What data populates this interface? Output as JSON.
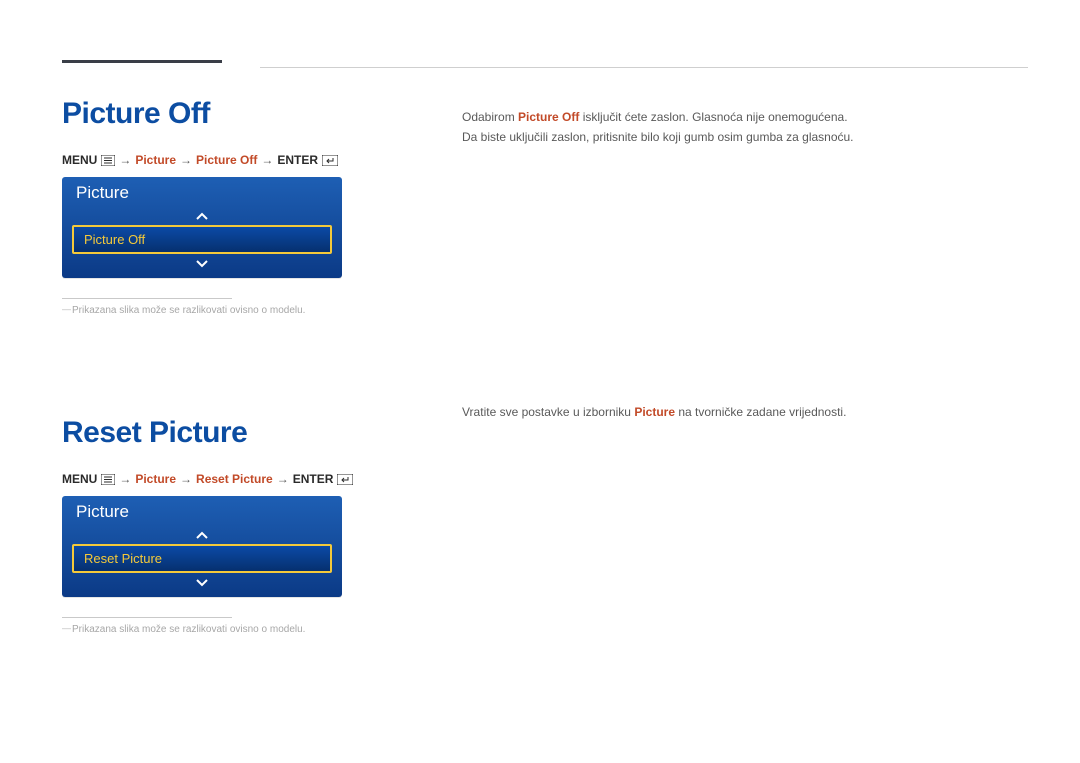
{
  "sections": [
    {
      "title": "Picture Off",
      "breadcrumb": {
        "menu_label": "MENU",
        "step1": "Picture",
        "step2": "Picture Off",
        "enter_label": "ENTER"
      },
      "osd": {
        "title": "Picture",
        "selected": "Picture Off"
      },
      "caption": "Prikazana slika može se razlikovati ovisno o modelu.",
      "body": {
        "line1_pre": "Odabirom ",
        "line1_hl": "Picture Off",
        "line1_post": " isključit ćete zaslon. Glasnoća nije onemogućena.",
        "line2": "Da biste uključili zaslon, pritisnite bilo koji gumb osim gumba za glasnoću."
      }
    },
    {
      "title": "Reset Picture",
      "breadcrumb": {
        "menu_label": "MENU",
        "step1": "Picture",
        "step2": "Reset Picture",
        "enter_label": "ENTER"
      },
      "osd": {
        "title": "Picture",
        "selected": "Reset Picture"
      },
      "caption": "Prikazana slika može se razlikovati ovisno o modelu.",
      "body": {
        "line1_pre": "Vratite sve postavke u izborniku ",
        "line1_hl": "Picture",
        "line1_post": " na tvorničke zadane vrijednosti.",
        "line2": ""
      }
    }
  ]
}
